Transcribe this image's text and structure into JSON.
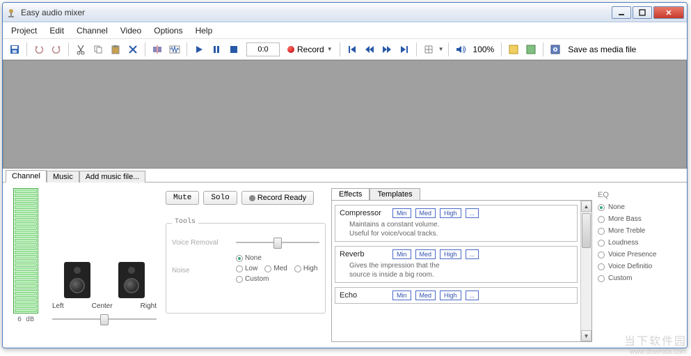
{
  "window": {
    "title": "Easy audio mixer"
  },
  "menu": {
    "project": "Project",
    "edit": "Edit",
    "channel": "Channel",
    "video": "Video",
    "options": "Options",
    "help": "Help"
  },
  "toolbar": {
    "time": "0:0",
    "record_label": "Record",
    "volume_pct": "100%",
    "save_as": "Save as media file"
  },
  "tabs": {
    "channel": "Channel",
    "music": "Music",
    "add": "Add music file..."
  },
  "meter": {
    "db": "6 dB"
  },
  "balance": {
    "left": "Left",
    "center": "Center",
    "right": "Right"
  },
  "buttons": {
    "mute": "Mute",
    "solo": "Solo",
    "record_ready": "Record Ready"
  },
  "tools": {
    "title": "Tools",
    "voice_removal": "Voice Removal",
    "noise": "Noise",
    "none": "None",
    "low": "Low",
    "med": "Med",
    "high": "High",
    "custom": "Custom"
  },
  "effects": {
    "tab_effects": "Effects",
    "tab_templates": "Templates",
    "min": "Min",
    "med": "Med",
    "high": "High",
    "more": "...",
    "items": [
      {
        "name": "Compressor",
        "desc1": "Maintains a constant volume.",
        "desc2": "Useful for voice/vocal tracks."
      },
      {
        "name": "Reverb",
        "desc1": "Gives the impression that the",
        "desc2": "source is inside a big room."
      },
      {
        "name": "Echo",
        "desc1": "",
        "desc2": ""
      }
    ]
  },
  "eq": {
    "title": "EQ",
    "none": "None",
    "more_bass": "More Bass",
    "more_treble": "More Treble",
    "loudness": "Loudness",
    "voice_presence": "Voice Presence",
    "voice_definition": "Voice Definitio",
    "custom": "Custom"
  },
  "watermark": {
    "line1": "当下软件园",
    "line2": "www.downxia.com"
  }
}
